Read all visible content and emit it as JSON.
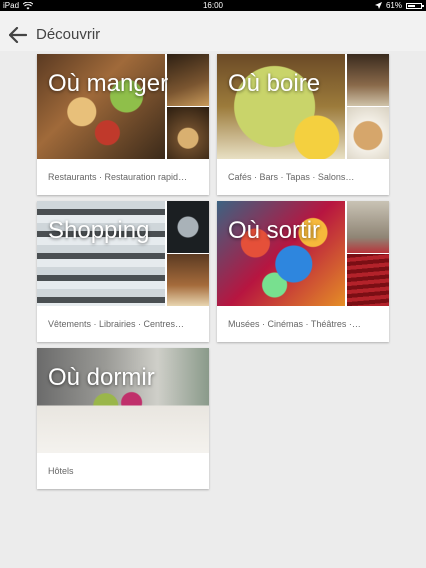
{
  "status_bar": {
    "device": "iPad",
    "time": "16:00",
    "battery": "61%",
    "battery_level": 0.61
  },
  "header": {
    "title": "Découvrir"
  },
  "categories": [
    {
      "label": "Où manger",
      "subcategories": "Restaurants · Restauration rapid…"
    },
    {
      "label": "Où boire",
      "subcategories": "Cafés · Bars · Tapas · Salons…"
    },
    {
      "label": "Shopping",
      "subcategories": "Vêtements · Librairies · Centres…"
    },
    {
      "label": "Où sortir",
      "subcategories": "Musées · Cinémas · Théâtres ·…"
    },
    {
      "label": "Où dormir",
      "subcategories": "Hôtels"
    }
  ]
}
